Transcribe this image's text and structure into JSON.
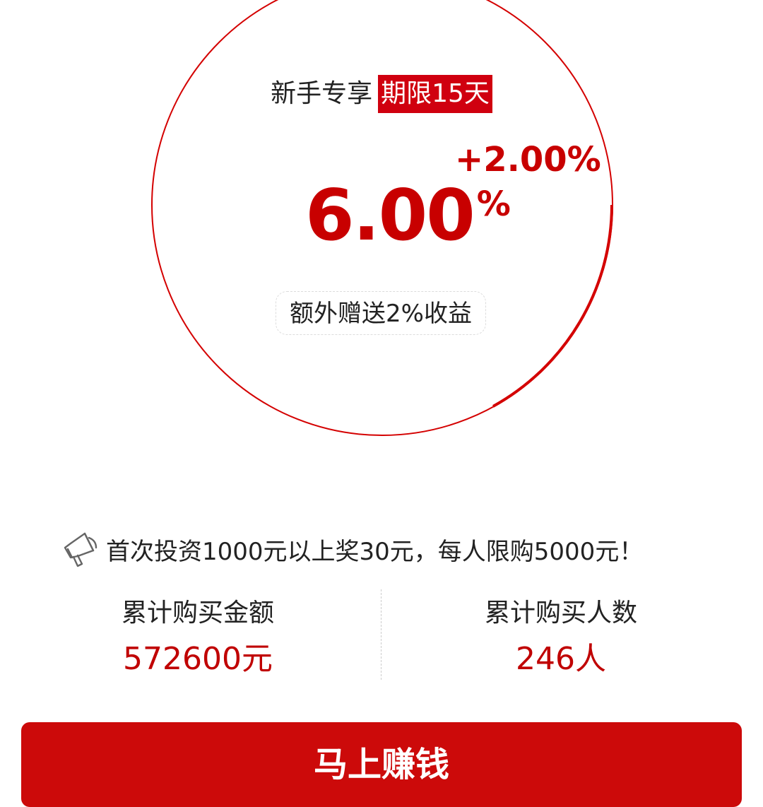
{
  "hero": {
    "tag_text": "新手专享",
    "tag_highlight": "期限15天",
    "bonus_rate": "+2.00%",
    "rate_value": "6.00",
    "rate_unit": "%",
    "extra_note": "额外赠送2%收益"
  },
  "notice": {
    "icon": "megaphone-icon",
    "text": "首次投资1000元以上奖30元，每人限购5000元！"
  },
  "stats": {
    "total_amount_label": "累计购买金额",
    "total_amount_value": "572600元",
    "total_buyers_label": "累计购买人数",
    "total_buyers_value": "246人"
  },
  "action": {
    "buy_label": "马上赚钱"
  },
  "colors": {
    "accent": "#c80000",
    "button": "#cc0a0a",
    "text": "#222222"
  }
}
